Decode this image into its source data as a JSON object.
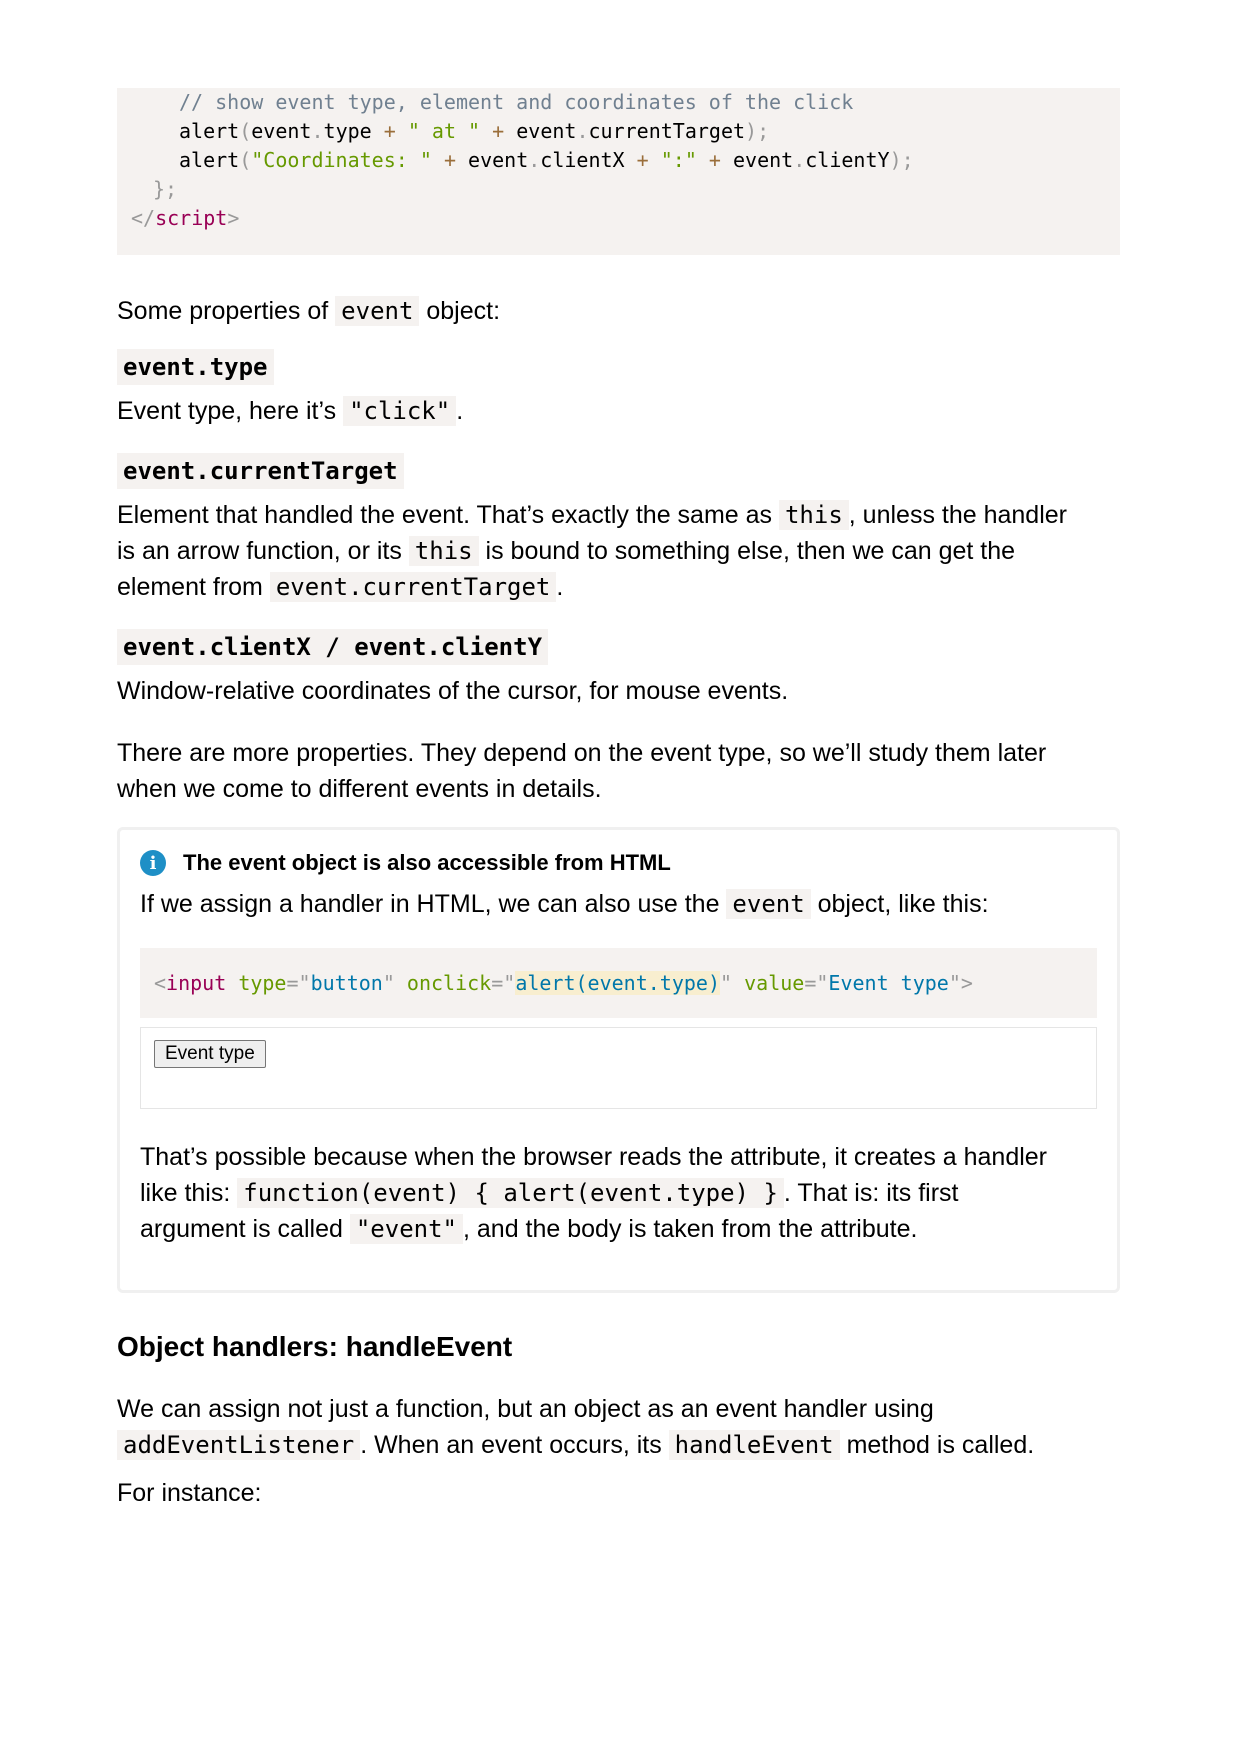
{
  "code_top": {
    "comment": "// show event type, element and coordinates of the click",
    "alert": "alert",
    "event": "event",
    "type_prop": "type",
    "plus": "+",
    "str_at": "\" at \"",
    "currentTarget": "currentTarget",
    "str_coords": "\"Coordinates: \"",
    "clientX": "clientX",
    "str_colon": "\":\"",
    "clientY": "clientY",
    "close_brace": "};",
    "script_tag": "script"
  },
  "intro": {
    "before": "Some properties of",
    "code": "event",
    "after": "object:"
  },
  "props": [
    {
      "name": "event.type",
      "desc_before": "Event type, here it’s",
      "desc_code": "\"click\"",
      "desc_after": "."
    },
    {
      "name": "event.currentTarget"
    },
    {
      "name": "event.clientX / event.clientY",
      "desc": "Window-relative coordinates of the cursor, for mouse events."
    }
  ],
  "current_target_desc": {
    "p1": "Element that handled the event. That’s exactly the same as",
    "c1": "this",
    "p2": ", unless the handler",
    "p3": "is an arrow function, or its",
    "c2": "this",
    "p4": "is bound to something else, then we can get the",
    "p5": "element from",
    "c3": "event.currentTarget",
    "p6": "."
  },
  "more_props": {
    "line1": "There are more properties. They depend on the event type, so we’ll study them later",
    "line2": "when we come to different events in details."
  },
  "info": {
    "title": "The event object is also accessible from HTML",
    "p_before": "If we assign a handler in HTML, we can also use the",
    "p_code": "event",
    "p_after": "object, like this:",
    "code": {
      "tag": "input",
      "attr_type": "type",
      "val_type": "button",
      "attr_onclick": "onclick",
      "val_onclick": "alert(event.type)",
      "attr_value": "value",
      "val_value": "Event type"
    },
    "demo_button": "Event type",
    "after_l1": "That’s possible because when the browser reads the attribute, it creates a handler",
    "after_l2_before": "like this:",
    "after_l2_code": "function(event) { alert(event.type) }",
    "after_l2_after": ". That is: its first",
    "after_l3_before": "argument is called",
    "after_l3_code": "\"event\"",
    "after_l3_after": ", and the body is taken from the attribute."
  },
  "section": {
    "title": "Object handlers: handleEvent",
    "p1_l1": "We can assign not just a function, but an object as an event handler using",
    "p1_code1": "addEventListener",
    "p1_mid": ". When an event occurs, its",
    "p1_code2": "handleEvent",
    "p1_after": "method is called.",
    "p2": "For instance:"
  }
}
